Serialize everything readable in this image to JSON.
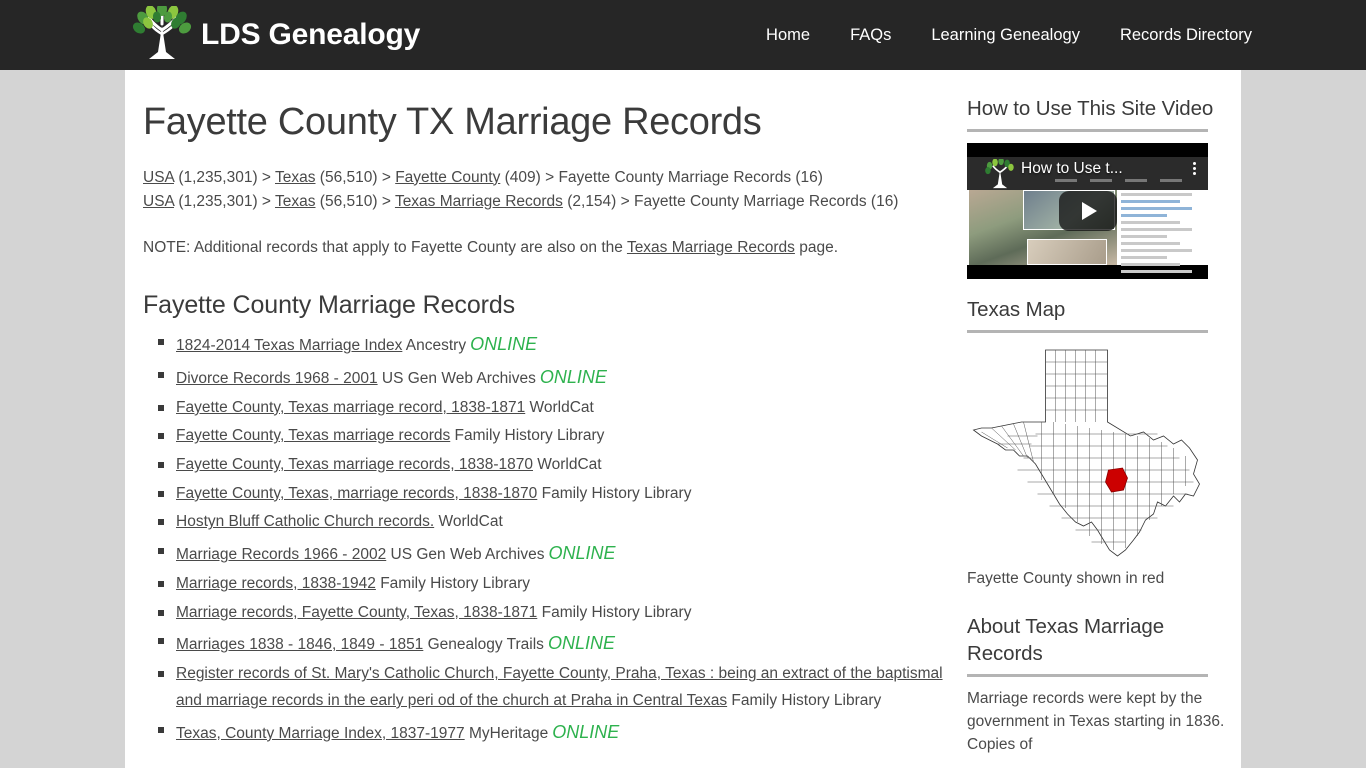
{
  "header": {
    "brand_name": "LDS Genealogy",
    "nav": [
      {
        "label": "Home"
      },
      {
        "label": "FAQs"
      },
      {
        "label": "Learning Genealogy"
      },
      {
        "label": "Records Directory"
      }
    ]
  },
  "main": {
    "page_title": "Fayette County TX Marriage Records",
    "breadcrumb_line1": [
      {
        "text": "USA",
        "link": true
      },
      {
        "text": " (1,235,301) > ",
        "link": false
      },
      {
        "text": "Texas",
        "link": true
      },
      {
        "text": " (56,510) > ",
        "link": false
      },
      {
        "text": "Fayette County",
        "link": true
      },
      {
        "text": " (409) > Fayette County Marriage Records (16)",
        "link": false
      }
    ],
    "breadcrumb_line2": [
      {
        "text": "USA",
        "link": true
      },
      {
        "text": " (1,235,301) > ",
        "link": false
      },
      {
        "text": "Texas",
        "link": true
      },
      {
        "text": " (56,510) > ",
        "link": false
      },
      {
        "text": "Texas Marriage Records",
        "link": true
      },
      {
        "text": " (2,154) > Fayette County Marriage Records (16)",
        "link": false
      }
    ],
    "note_prefix": "NOTE: Additional records that apply to Fayette County are also on the ",
    "note_link": "Texas Marriage Records",
    "note_suffix": " page.",
    "section_heading": "Fayette County Marriage Records",
    "records": [
      {
        "title": "1824-2014 Texas Marriage Index",
        "source": "Ancestry",
        "online": "ONLINE"
      },
      {
        "title": "Divorce Records 1968 - 2001",
        "source": "US Gen Web Archives",
        "online": "ONLINE"
      },
      {
        "title": "Fayette County, Texas marriage record, 1838-1871",
        "source": "WorldCat",
        "online": ""
      },
      {
        "title": "Fayette County, Texas marriage records",
        "source": "Family History Library",
        "online": ""
      },
      {
        "title": "Fayette County, Texas marriage records, 1838-1870",
        "source": "WorldCat",
        "online": ""
      },
      {
        "title": "Fayette County, Texas, marriage records, 1838-1870",
        "source": "Family History Library",
        "online": ""
      },
      {
        "title": "Hostyn Bluff Catholic Church records.",
        "source": "WorldCat",
        "online": ""
      },
      {
        "title": "Marriage Records 1966 - 2002",
        "source": "US Gen Web Archives",
        "online": "ONLINE"
      },
      {
        "title": "Marriage records, 1838-1942",
        "source": "Family History Library",
        "online": ""
      },
      {
        "title": "Marriage records, Fayette County, Texas, 1838-1871",
        "source": "Family History Library",
        "online": ""
      },
      {
        "title": "Marriages 1838 - 1846, 1849 - 1851",
        "source": "Genealogy Trails",
        "online": "ONLINE"
      },
      {
        "title": "Register records of St. Mary's Catholic Church, Fayette County, Praha, Texas : being an extract of the baptismal and marriage records in the early peri od of the church at Praha in Central Texas",
        "source": "Family History Library",
        "online": ""
      },
      {
        "title": "Texas, County Marriage Index, 1837-1977",
        "source": "MyHeritage",
        "online": "ONLINE"
      }
    ]
  },
  "sidebar": {
    "video_heading": "How to Use This Site Video",
    "video_title": "How to Use t...",
    "map_heading": "Texas Map",
    "map_caption": "Fayette County shown in red",
    "about_heading": "About Texas Marriage Records",
    "about_text": "Marriage records were kept by the government in Texas starting in 1836. Copies of"
  },
  "colors": {
    "header_bg": "#262626",
    "page_bg": "#d4d4d4",
    "online_green": "#2eb24e",
    "county_red": "#cc0000",
    "text": "#4a4a4a"
  }
}
